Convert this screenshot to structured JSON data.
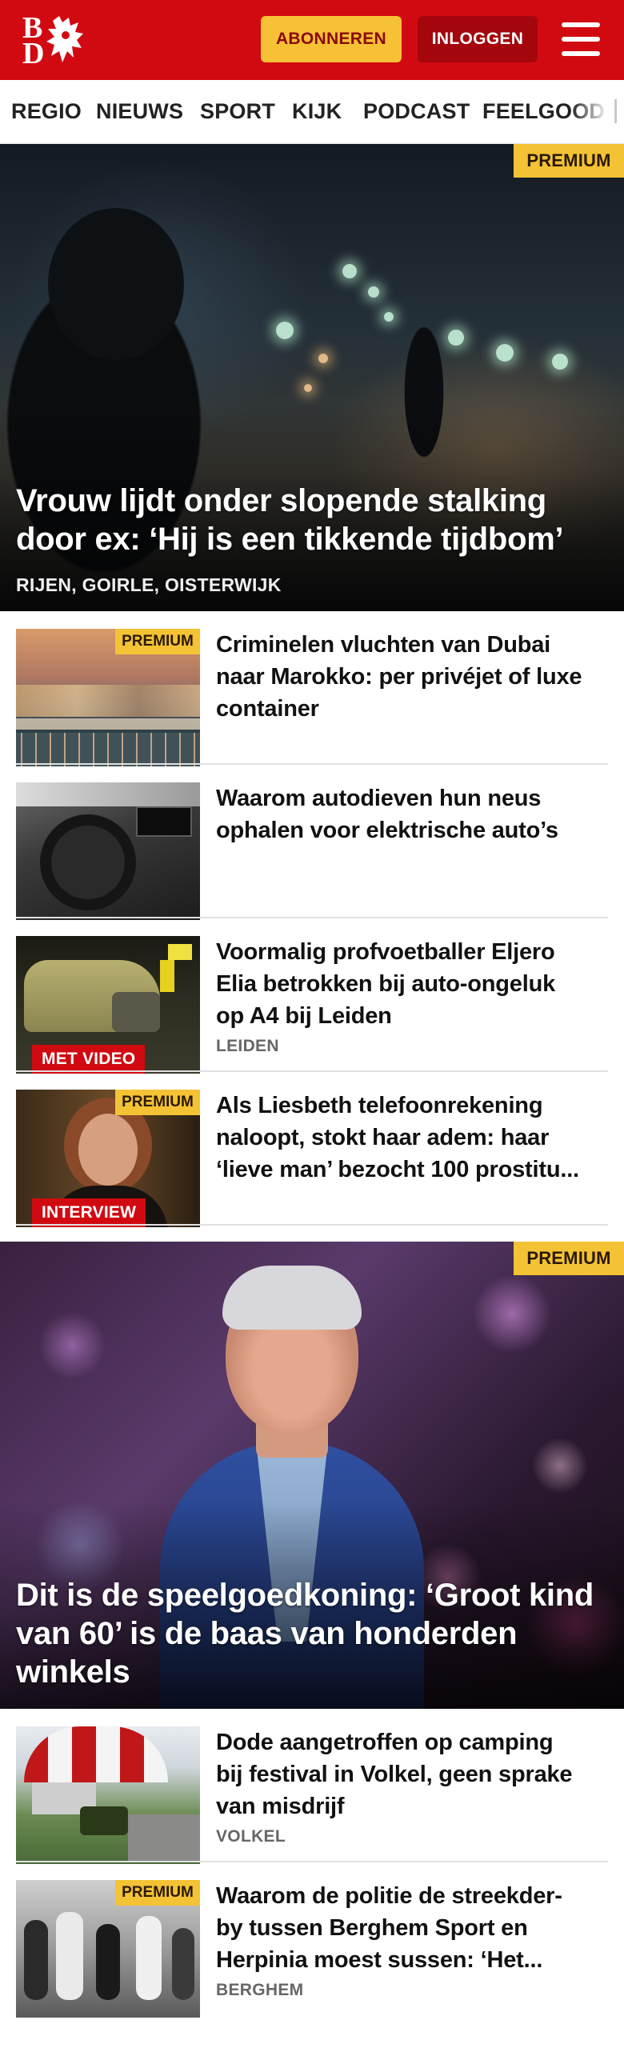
{
  "header": {
    "logo_text_top": "B",
    "logo_text_bottom": "D",
    "subscribe_label": "ABONNEREN",
    "login_label": "INLOGGEN",
    "brand_color": "#d10a11"
  },
  "nav": {
    "items": [
      "REGIO",
      "NIEUWS",
      "SPORT",
      "KIJK",
      "PODCAST",
      "FEELGOOD"
    ]
  },
  "hero1": {
    "premium": "PREMIUM",
    "title_line1": "Vrouw lijdt onder slopende stalking",
    "title_line2": "door ex: ‘Hij is een tikkende tijdbom’",
    "tag": "RIJEN, GOIRLE, OISTERWIJK"
  },
  "articles": [
    {
      "premium": "PREMIUM",
      "title_lines": [
        "Criminelen vluchten van Dubai",
        "naar Marokko: per privéjet of luxe",
        "container"
      ]
    },
    {
      "title_lines": [
        "Waarom autodieven hun neus",
        "ophalen voor elektrische auto’s"
      ]
    },
    {
      "badge": "MET VIDEO",
      "title_lines": [
        "Voormalig profvoetballer Eljero",
        "Elia betrokken bij auto-ongeluk",
        "op A4 bij Leiden"
      ],
      "tag": "LEIDEN"
    },
    {
      "premium": "PREMIUM",
      "badge": "INTERVIEW",
      "title_lines": [
        "Als Liesbeth telefoonrekening",
        "naloopt, stokt haar adem: haar",
        "‘lieve man’ bezocht 100 prostitu..."
      ]
    }
  ],
  "hero2": {
    "premium": "PREMIUM",
    "title_line1": "Dit is de speelgoedkoning: ‘Groot kind",
    "title_line2": "van 60’ is de baas van honderden",
    "title_line3": "winkels"
  },
  "articles2": [
    {
      "title_lines": [
        "Dode aangetroffen op camping",
        "bij festival in Volkel, geen sprake",
        "van misdrijf"
      ],
      "tag": "VOLKEL"
    },
    {
      "premium": "PREMIUM",
      "title_lines": [
        "Waarom de politie de streekder-",
        "by tussen Berghem Sport en",
        "Herpinia moest sussen: ‘Het..."
      ],
      "tag": "BERGHEM"
    }
  ],
  "icons": {
    "menu": "hamburger-menu-icon",
    "logo": "lion-logo-icon"
  }
}
